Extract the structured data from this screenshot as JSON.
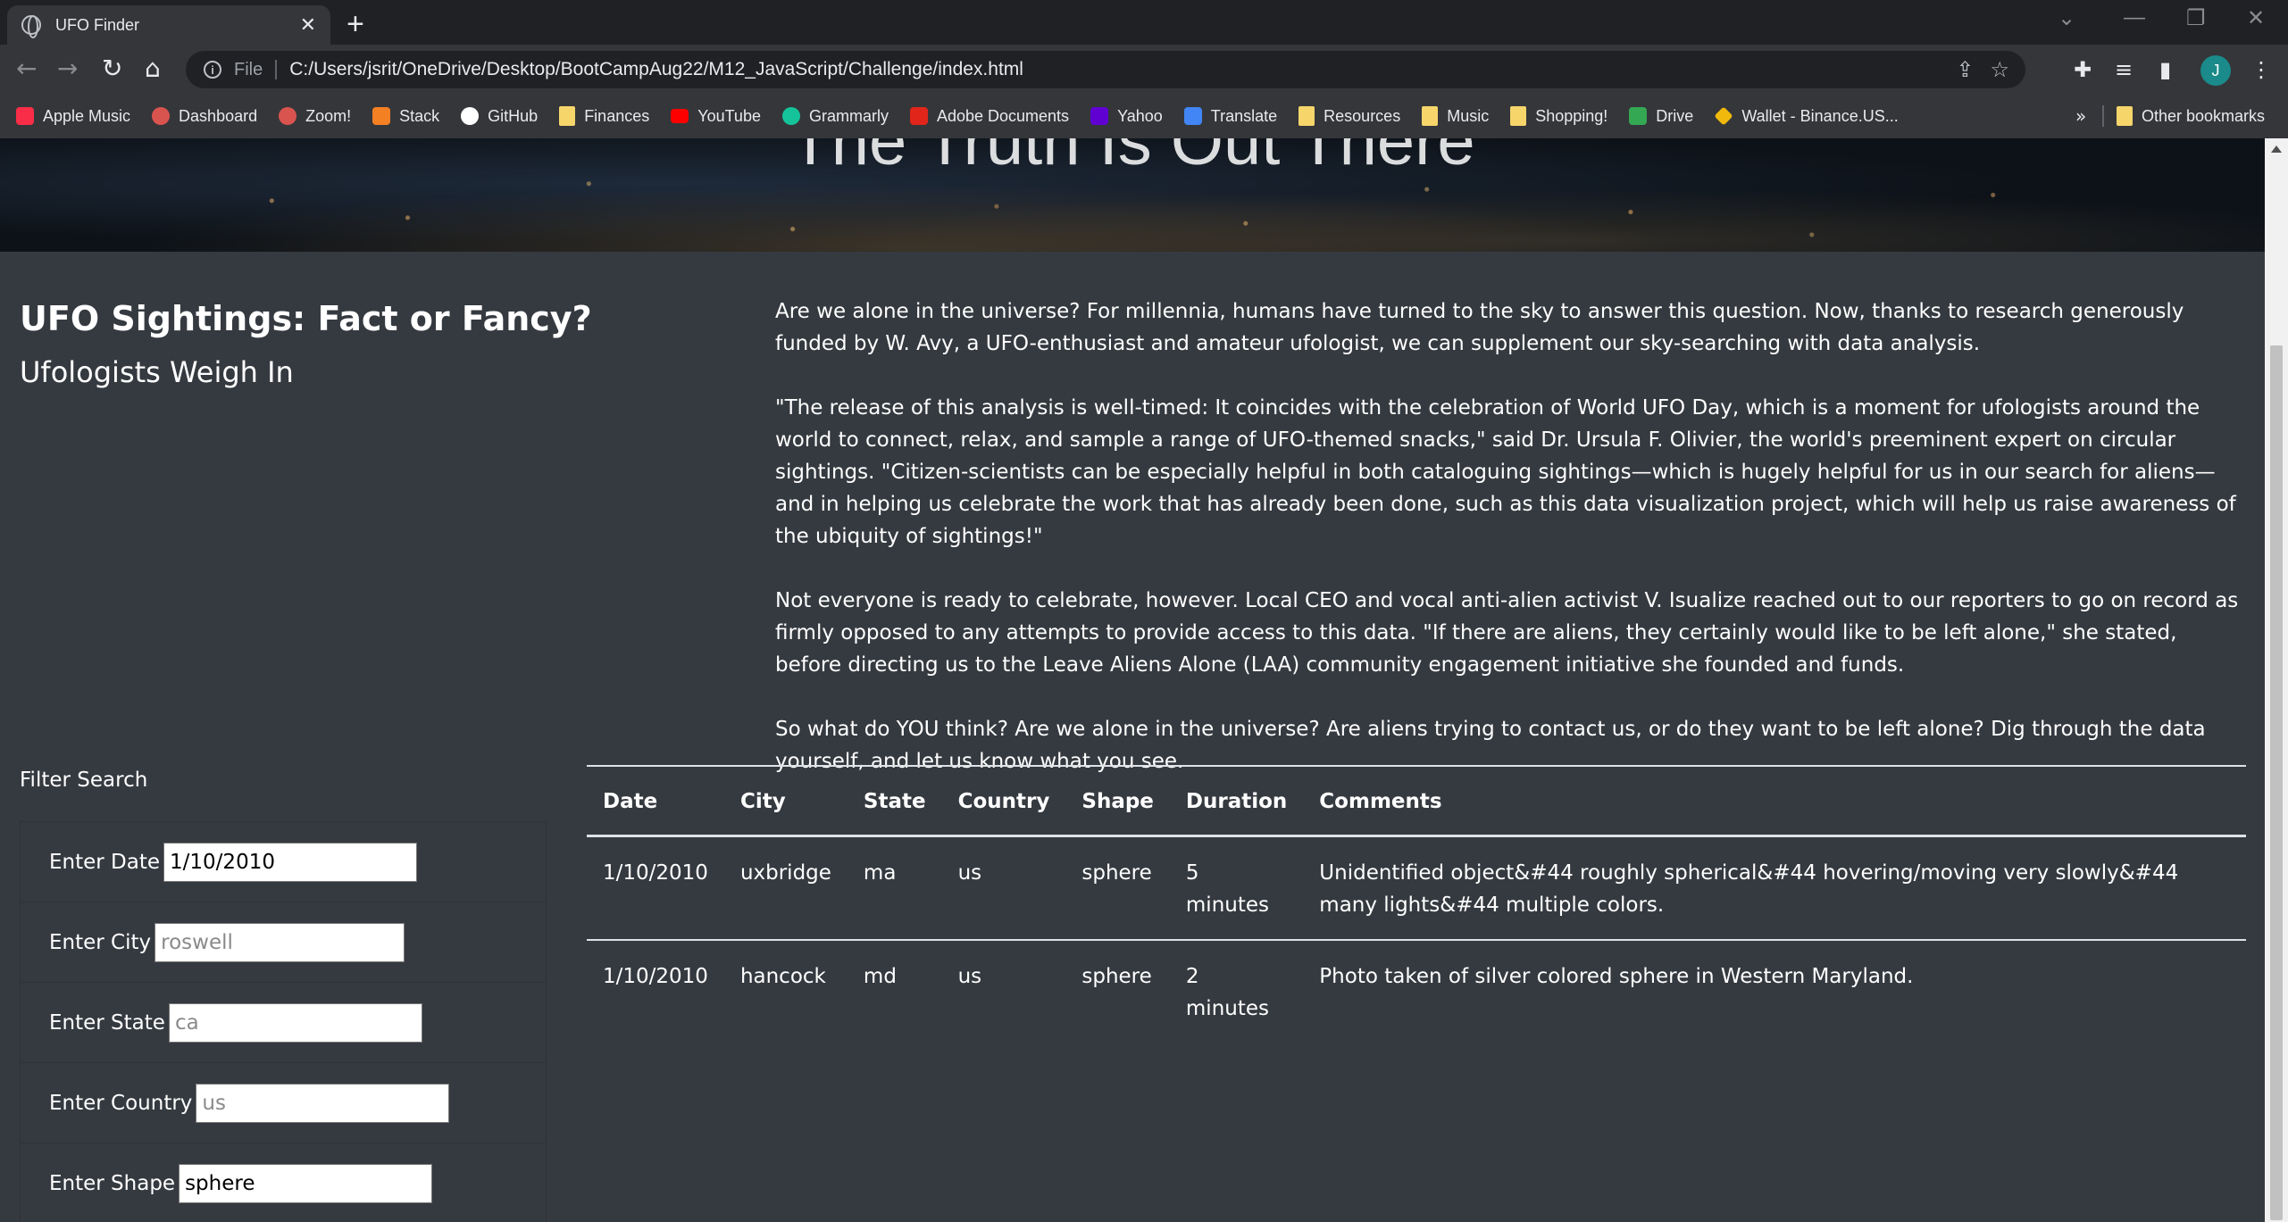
{
  "browser": {
    "tab_title": "UFO Finder",
    "url_scheme": "File",
    "url": "C:/Users/jsrit/OneDrive/Desktop/BootCampAug22/M12_JavaScript/Challenge/index.html",
    "avatar_letter": "J",
    "bookmarks": [
      {
        "label": "Apple Music",
        "icon": "apple-music-icon",
        "color": "#fa2d48"
      },
      {
        "label": "Dashboard",
        "icon": "dashboard-icon",
        "color": "#d9534f"
      },
      {
        "label": "Zoom!",
        "icon": "zoom-icon",
        "color": "#d9534f"
      },
      {
        "label": "Stack",
        "icon": "stack-overflow-icon",
        "color": "#f48024"
      },
      {
        "label": "GitHub",
        "icon": "github-icon",
        "color": "#ffffff"
      },
      {
        "label": "Finances",
        "icon": "folder-icon",
        "color": "#f6d56b"
      },
      {
        "label": "YouTube",
        "icon": "youtube-icon",
        "color": "#ff0000"
      },
      {
        "label": "Grammarly",
        "icon": "grammarly-icon",
        "color": "#15c39a"
      },
      {
        "label": "Adobe Documents",
        "icon": "adobe-icon",
        "color": "#e1251b"
      },
      {
        "label": "Yahoo",
        "icon": "yahoo-icon",
        "color": "#6001d2"
      },
      {
        "label": "Translate",
        "icon": "translate-icon",
        "color": "#4285f4"
      },
      {
        "label": "Resources",
        "icon": "folder-icon",
        "color": "#f6d56b"
      },
      {
        "label": "Music",
        "icon": "folder-icon",
        "color": "#f6d56b"
      },
      {
        "label": "Shopping!",
        "icon": "folder-icon",
        "color": "#f6d56b"
      },
      {
        "label": "Drive",
        "icon": "google-drive-icon",
        "color": "#34a853"
      },
      {
        "label": "Wallet - Binance.US...",
        "icon": "binance-icon",
        "color": "#f0b90b"
      }
    ],
    "more_label": "»",
    "other_bookmarks": "Other bookmarks"
  },
  "hero": {
    "title": "The Truth Is Out There"
  },
  "heading": {
    "main": "UFO Sightings: Fact or Fancy?",
    "sub": "Ufologists Weigh In"
  },
  "article": {
    "paragraphs": [
      "Are we alone in the universe? For millennia, humans have turned to the sky to answer this question. Now, thanks to research generously funded by W. Avy, a UFO-enthusiast and amateur ufologist, we can supplement our sky-searching with data analysis.",
      "\"The release of this analysis is well-timed: It coincides with the celebration of World UFO Day, which is a moment for ufologists around the world to connect, relax, and sample a range of UFO-themed snacks,\" said Dr. Ursula F. Olivier, the world's preeminent expert on circular sightings. \"Citizen-scientists can be especially helpful in both cataloguing sightings—which is hugely helpful for us in our search for aliens—and in helping us celebrate the work that has already been done, such as this data visualization project, which will help us raise awareness of the ubiquity of sightings!\"",
      "Not everyone is ready to celebrate, however. Local CEO and vocal anti-alien activist V. Isualize reached out to our reporters to go on record as firmly opposed to any attempts to provide access to this data. \"If there are aliens, they certainly would like to be left alone,\" she stated, before directing us to the Leave Aliens Alone (LAA) community engagement initiative she founded and funds.",
      "So what do YOU think? Are we alone in the universe? Are aliens trying to contact us, or do they want to be left alone? Dig through the data yourself, and let us know what you see."
    ]
  },
  "filters": {
    "title": "Filter Search",
    "fields": [
      {
        "label": "Enter Date",
        "value": "1/10/2010",
        "placeholder": "1/10/2010"
      },
      {
        "label": "Enter City",
        "value": "",
        "placeholder": "roswell"
      },
      {
        "label": "Enter State",
        "value": "",
        "placeholder": "ca"
      },
      {
        "label": "Enter Country",
        "value": "",
        "placeholder": "us"
      },
      {
        "label": "Enter Shape",
        "value": "sphere",
        "placeholder": "sphere"
      }
    ]
  },
  "table": {
    "headers": [
      "Date",
      "City",
      "State",
      "Country",
      "Shape",
      "Duration",
      "Comments"
    ],
    "rows": [
      [
        "1/10/2010",
        "uxbridge",
        "ma",
        "us",
        "sphere",
        "5 minutes",
        "Unidentified object&#44 roughly spherical&#44 hovering/moving very slowly&#44 many lights&#44 multiple colors."
      ],
      [
        "1/10/2010",
        "hancock",
        "md",
        "us",
        "sphere",
        "2 minutes",
        "Photo taken of silver colored sphere in Western Maryland."
      ]
    ]
  }
}
